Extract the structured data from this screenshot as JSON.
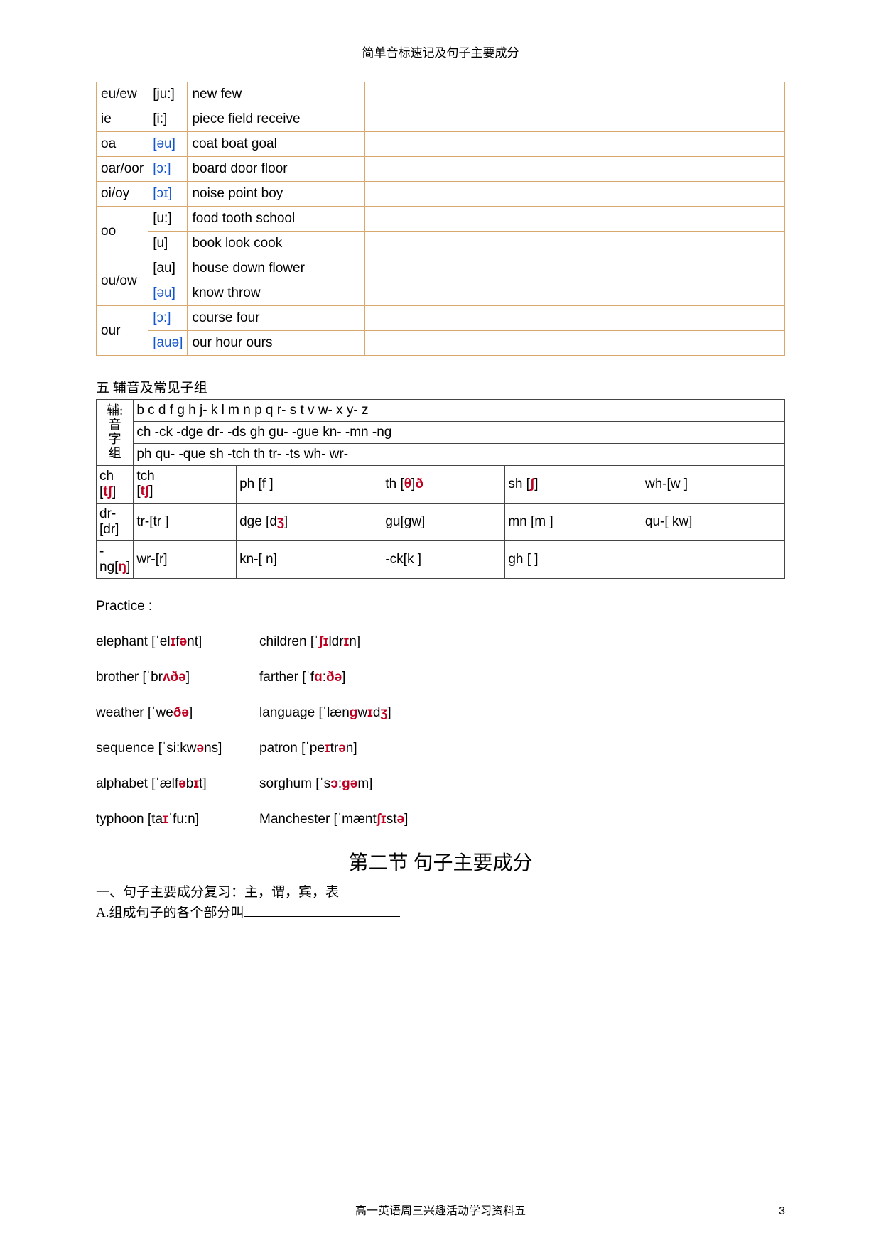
{
  "topTitle": "简单音标速记及句子主要成分",
  "table1": {
    "rows": [
      {
        "a": "eu/ew",
        "b": "[ju:]",
        "c": "new few",
        "d": ""
      },
      {
        "a": "ie",
        "b": "[i:]",
        "c": "piece field receive",
        "d": ""
      },
      {
        "a": "oa",
        "b": "[əu]",
        "bClass": "ipa-blue",
        "c": "coat boat goal",
        "d": ""
      },
      {
        "a": "oar/oor",
        "b": "[ɔ:]",
        "bClass": "ipa-blue",
        "c": "board door floor",
        "d": ""
      },
      {
        "a": "oi/oy",
        "b": "[ɔɪ]",
        "bClass": "ipa-blue",
        "c": "noise point boy",
        "d": ""
      },
      {
        "a": "oo",
        "rowspan": 2,
        "b": "[u:]",
        "c": "food tooth school",
        "d": ""
      },
      {
        "b": "[u]",
        "c": "book look cook",
        "d": ""
      },
      {
        "a": "ou/ow",
        "rowspan": 2,
        "b": "[au]",
        "c": "  house down flower",
        "d": ""
      },
      {
        "b": "[əu]",
        "bClass": "ipa-blue",
        "c": "know throw",
        "d": ""
      },
      {
        "a": "our",
        "rowspan": 2,
        "b": "[ɔ:]",
        "bClass": "ipa-blue",
        "c": "course four",
        "d": ""
      },
      {
        "b": "[auə]",
        "bClass": "ipa-blue",
        "c": "our hour ours",
        "d": ""
      }
    ]
  },
  "section5Label": "五 辅音及常见子组",
  "table2": {
    "vheader": [
      "辅:",
      "音",
      "字",
      "组"
    ],
    "top": [
      "b c d f g h j- k l m n p q r- s t v w- x y- z",
      "ch -ck -dge dr- -ds gh gu- -gue kn- -mn -ng",
      "ph qu- -que sh -tch th tr- -ts wh- wr-"
    ],
    "grid": [
      [
        {
          "html": "ch [<span class='ipa-red'>tʃ</span>]"
        },
        {
          "html": "tch<br>[<span class='ipa-red'>tʃ</span>]",
          "cls": "tch-cell"
        },
        {
          "html": "ph [f ]"
        },
        {
          "html": "th [<span class='ipa-red'>θ</span>]<span class='ipa-red'>ð</span>"
        },
        {
          "html": "sh [<span class='ipa-red'>ʃ</span>]"
        },
        {
          "html": "wh-[w ]"
        }
      ],
      [
        {
          "html": "dr-[dr]"
        },
        {
          "html": "tr-[tr ]"
        },
        {
          "html": "dge [d<span class='ipa-red'>ʒ</span>]"
        },
        {
          "html": "gu[gw]"
        },
        {
          "html": "mn [m ]"
        },
        {
          "html": "qu-[ kw]"
        }
      ],
      [
        {
          "html": "-ng[<span class='ipa-red'>ŋ</span>]"
        },
        {
          "html": "wr-[r]"
        },
        {
          "html": "kn-[ n]"
        },
        {
          "html": "-ck[k ]"
        },
        {
          "html": "gh [ ]"
        },
        {
          "html": ""
        }
      ]
    ]
  },
  "practiceLabel": "Practice :",
  "practice": [
    {
      "l": "elephant [ˈel<span class='ipa-red'>ɪ</span>f<span class='ipa-red'>ə</span>nt]",
      "r": "children [ˈ<span class='ipa-red'>ʃɪ</span>ldr<span class='ipa-red'>ɪ</span>n]"
    },
    {
      "l": "brother [ˈbr<span class='ipa-red'>ʌðə</span>]",
      "r": "farther [ˈf<span class='ipa-red'>ɑ</span>:<span class='ipa-red'>ðə</span>]"
    },
    {
      "l": "weather [ˈwe<span class='ipa-red'>ðə</span>]",
      "r": "language [ˈlæn<span class='ipa-red'>ɡ</span>w<span class='ipa-red'>ɪ</span>d<span class='ipa-red'>ʒ</span>]"
    },
    {
      "l": "sequence [ˈsi:kw<span class='ipa-red'>ə</span>ns]",
      "r": "patron [ˈpe<span class='ipa-red'>ɪ</span>tr<span class='ipa-red'>ə</span>n]"
    },
    {
      "l": "alphabet [ˈælf<span class='ipa-red'>ə</span>b<span class='ipa-red'>ɪ</span>t]",
      "r": "sorghum [ˈs<span class='ipa-red'>ɔ</span>:<span class='ipa-red'>ɡə</span>m]"
    },
    {
      "l": "typhoon [ta<span class='ipa-red'>ɪ</span>ˈfu:n]",
      "r": "Manchester [ˈmænt<span class='ipa-red'>ʃɪ</span>st<span class='ipa-red'>ə</span>]"
    }
  ],
  "section2Title": "第二节  句子主要成分",
  "review1": "一、句子主要成分复习：主，谓，宾，表",
  "review2": "A.组成句子的各个部分叫",
  "footer": "高一英语周三兴趣活动学习资料五",
  "pageNum": "3"
}
